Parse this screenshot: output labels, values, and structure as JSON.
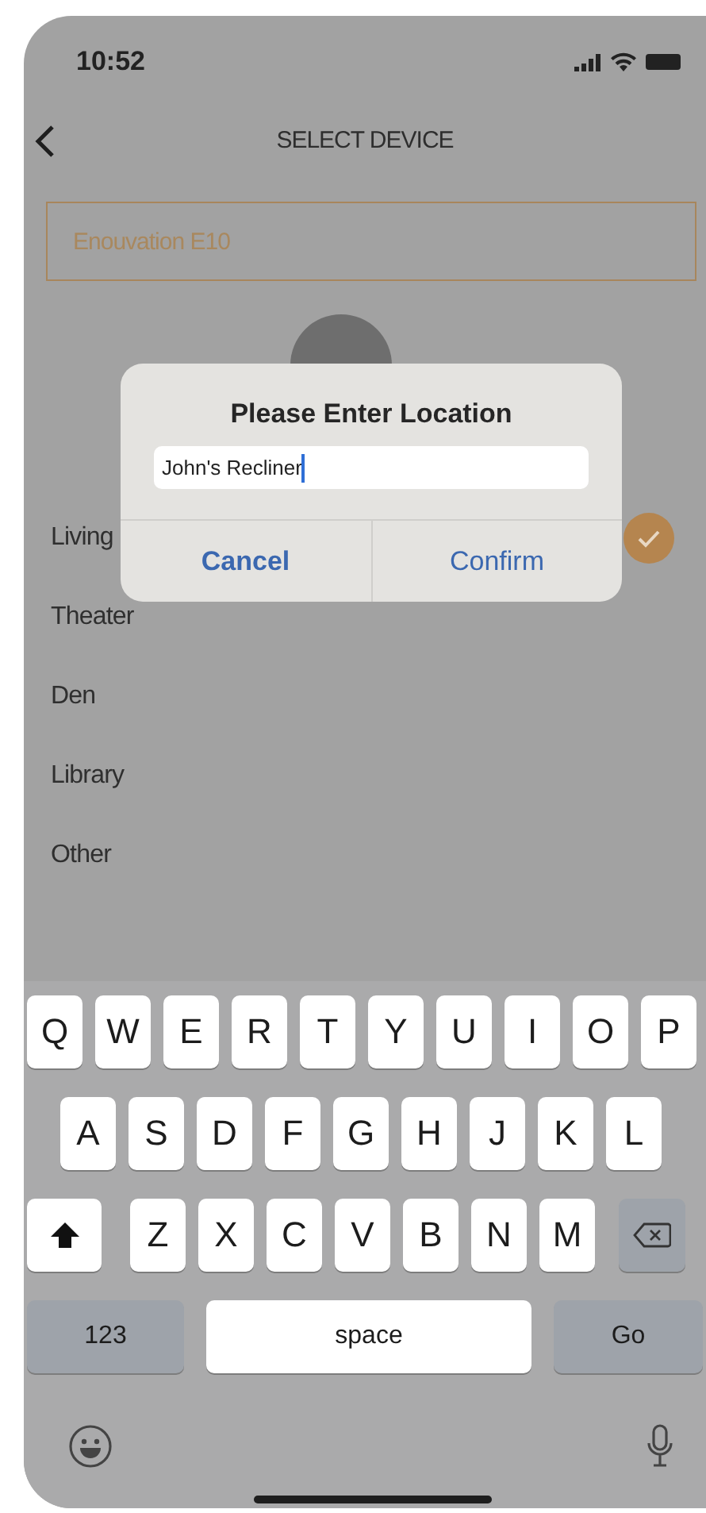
{
  "status_bar": {
    "time": "10:52"
  },
  "nav": {
    "title": "SELECT DEVICE"
  },
  "device_field": {
    "value": "Enouvation E10"
  },
  "dialog": {
    "title": "Please Enter Location",
    "input_value": "John's Recliner",
    "buttons": [
      {
        "label": "Cancel",
        "kind": "cancel"
      },
      {
        "label": "Confirm",
        "kind": "confirm"
      }
    ]
  },
  "locations": [
    {
      "label": "Living",
      "selected": true
    },
    {
      "label": "Theater",
      "selected": false
    },
    {
      "label": "Den",
      "selected": false
    },
    {
      "label": "Library",
      "selected": false
    },
    {
      "label": "Other",
      "selected": false
    }
  ],
  "keyboard": {
    "rows": [
      [
        "Q",
        "W",
        "E",
        "R",
        "T",
        "Y",
        "U",
        "I",
        "O",
        "P"
      ],
      [
        "A",
        "S",
        "D",
        "F",
        "G",
        "H",
        "J",
        "K",
        "L"
      ],
      [
        "Z",
        "X",
        "C",
        "V",
        "B",
        "N",
        "M"
      ]
    ],
    "numbers_key": "123",
    "space_key": "space",
    "go_key": "Go"
  }
}
